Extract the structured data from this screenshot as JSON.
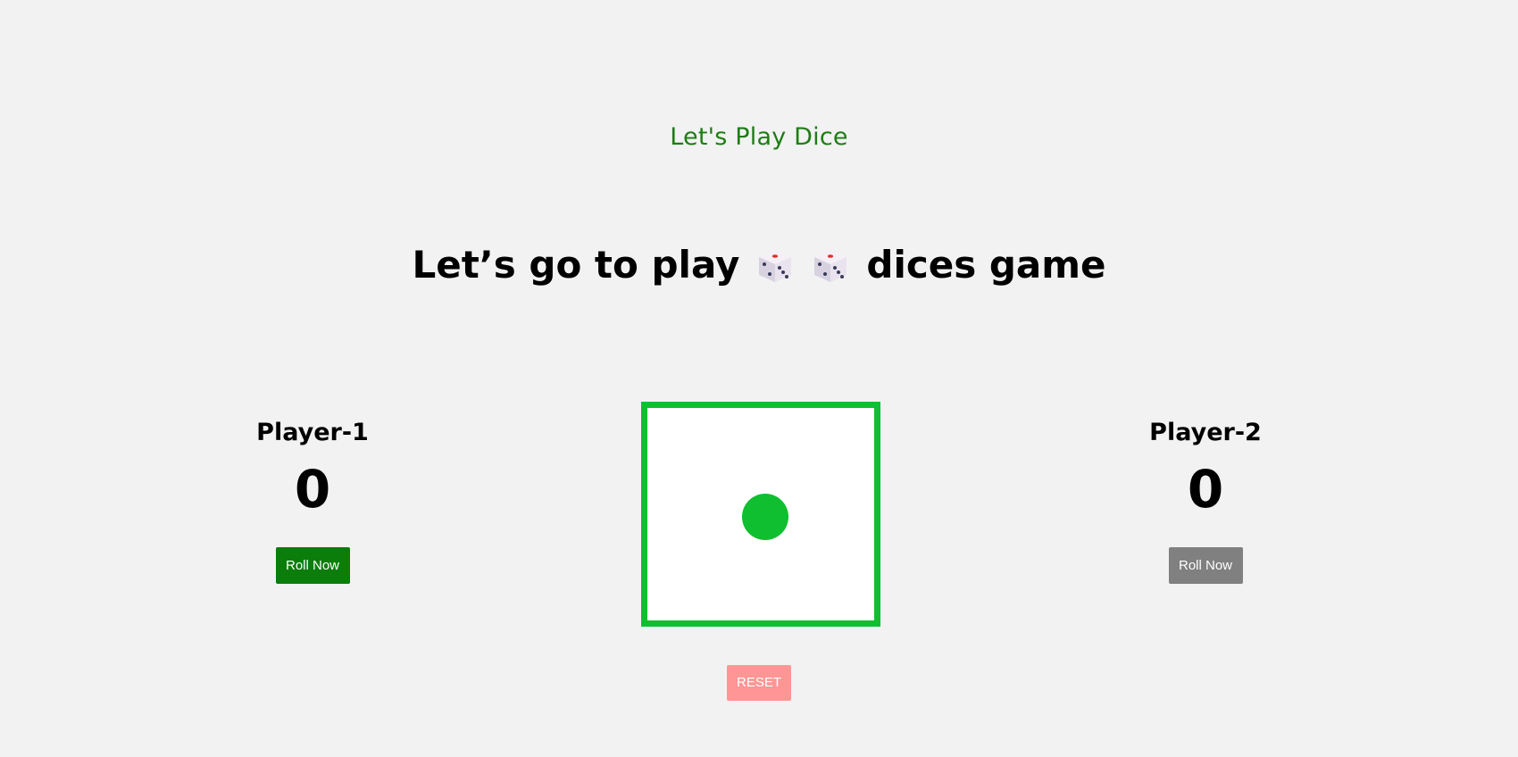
{
  "header": {
    "subtitle": "Let's Play Dice",
    "headline_before": "Let’s go to play",
    "headline_after": "dices game",
    "headline_icons": [
      "dice-icon",
      "dice-icon"
    ]
  },
  "players": [
    {
      "name": "Player-1",
      "score": "0",
      "roll_label": "Roll Now",
      "roll_color": "#0a7d0a"
    },
    {
      "name": "Player-2",
      "score": "0",
      "roll_label": "Roll Now",
      "roll_color": "#808080"
    }
  ],
  "dice": {
    "face_value": 1,
    "border_color": "#0fbf2f",
    "pip_color": "#0fbf2f"
  },
  "controls": {
    "reset_label": "RESET",
    "reset_color": "#ff9595"
  },
  "colors": {
    "subtitle": "#1e7d14",
    "background": "#f2f2f2"
  }
}
